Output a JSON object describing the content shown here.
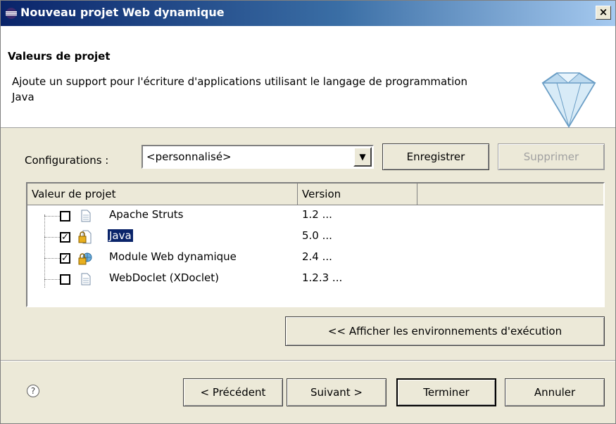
{
  "window": {
    "title": "Nouveau projet Web dynamique",
    "close_label": "×"
  },
  "banner": {
    "title": "Valeurs de projet",
    "description": "Ajoute un support pour l'écriture d'applications utilisant le langage de programmation Java"
  },
  "configurations": {
    "label": "Configurations :",
    "selected": "<personnalisé>",
    "save_label": "Enregistrer",
    "delete_label": "Supprimer"
  },
  "table": {
    "columns": [
      "Valeur de projet",
      "Version"
    ],
    "rows": [
      {
        "name": "Apache Struts",
        "version": "1.2 ...",
        "checked": false,
        "icon": "document-icon"
      },
      {
        "name": "Java",
        "version": "5.0 ...",
        "checked": true,
        "icon": "java-lock-icon",
        "selected": true
      },
      {
        "name": "Module Web dynamique",
        "version": "2.4 ...",
        "checked": true,
        "icon": "web-module-lock-icon"
      },
      {
        "name": "WebDoclet (XDoclet)",
        "version": "1.2.3 ...",
        "checked": false,
        "icon": "document-icon"
      }
    ]
  },
  "runtime_button": "<< Afficher les environnements d'exécution",
  "footer": {
    "help": "?",
    "previous": "< Précédent",
    "next": "Suivant >",
    "finish": "Terminer",
    "cancel": "Annuler"
  },
  "colors": {
    "title_start": "#0a246a",
    "title_end": "#a6caf0",
    "selection": "#0a246a"
  }
}
